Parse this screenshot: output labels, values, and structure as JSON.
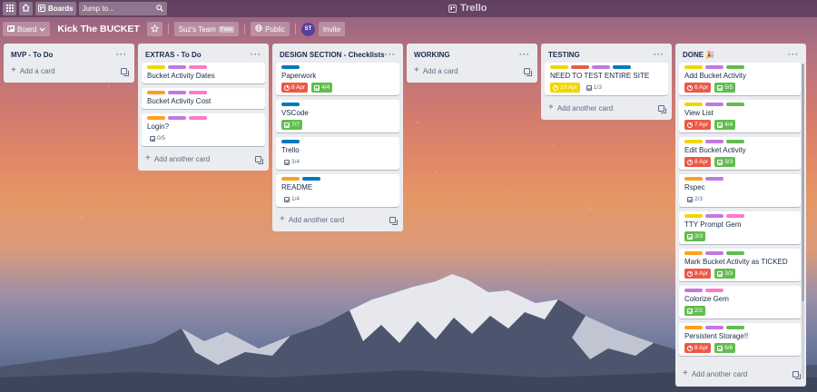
{
  "colors": {
    "yellow": "#f2d600",
    "purple": "#c377e0",
    "pink": "#ff78cb",
    "orange": "#ff9f1a",
    "blue": "#0079bf",
    "red": "#eb5a46",
    "green": "#61bd4f"
  },
  "topbar": {
    "apps_icon": "grid-icon",
    "home_icon": "home-icon",
    "boards_label": "Boards",
    "search_placeholder": "Jump to...",
    "logo_text": "Trello"
  },
  "boardbar": {
    "board_switcher_label": "Board",
    "board_title": "Kick The BUCKET",
    "team_label": "Suz's Team",
    "team_badge": "Free",
    "visibility_label": "Public",
    "avatar_initials": "ST",
    "invite_label": "Invite"
  },
  "add_card_label": "Add a card",
  "add_another_card_label": "Add another card",
  "lists": [
    {
      "title": "MVP - To Do",
      "cards": []
    },
    {
      "title": "EXTRAS - To Do",
      "cards": [
        {
          "title": "Bucket Activity Dates",
          "labels": [
            "yellow",
            "purple",
            "pink"
          ]
        },
        {
          "title": "Bucket Activity Cost",
          "labels": [
            "orange",
            "purple",
            "pink"
          ]
        },
        {
          "title": "Login?",
          "labels": [
            "orange",
            "purple",
            "pink"
          ],
          "checklist": "0/5"
        }
      ]
    },
    {
      "title": "DESIGN SECTION - Checklists",
      "cards": [
        {
          "title": "Paperwork",
          "labels": [
            "blue"
          ],
          "due": "8 Apr",
          "checklist_done": "4/4"
        },
        {
          "title": "VSCode",
          "labels": [
            "blue"
          ],
          "checklist_done": "7/7"
        },
        {
          "title": "Trello",
          "labels": [
            "blue"
          ],
          "checklist": "3/4"
        },
        {
          "title": "README",
          "labels": [
            "orange",
            "blue"
          ],
          "checklist": "1/4"
        }
      ]
    },
    {
      "title": "WORKING",
      "cards": []
    },
    {
      "title": "TESTING",
      "cards": [
        {
          "title": "NEED TO TEST ENTIRE SITE",
          "labels": [
            "yellow",
            "red",
            "purple",
            "blue"
          ],
          "due_yellow": "10 Apr",
          "checklist": "1/3"
        }
      ]
    },
    {
      "title": "DONE 🎉",
      "cards": [
        {
          "title": "Add Bucket Activity",
          "labels": [
            "yellow",
            "purple",
            "green"
          ],
          "due": "6 Apr",
          "checklist_done": "5/5"
        },
        {
          "title": "View List",
          "labels": [
            "yellow",
            "purple",
            "green"
          ],
          "due": "7 Apr",
          "checklist_done": "4/4"
        },
        {
          "title": "Edit Bucket Activity",
          "labels": [
            "yellow",
            "purple",
            "green"
          ],
          "due": "8 Apr",
          "checklist_done": "3/3"
        },
        {
          "title": "Rspec",
          "labels": [
            "orange",
            "purple"
          ],
          "checklist": "2/3"
        },
        {
          "title": "TTY Prompt Gem",
          "labels": [
            "yellow",
            "purple",
            "pink"
          ],
          "checklist_done": "3/3"
        },
        {
          "title": "Mark Bucket Activity as TICKED",
          "labels": [
            "orange",
            "purple",
            "green"
          ],
          "due": "8 Apr",
          "checklist_done": "3/3"
        },
        {
          "title": "Colorize Gem",
          "labels": [
            "purple",
            "pink"
          ],
          "checklist_done": "2/2"
        },
        {
          "title": "Persistent Storage!!",
          "labels": [
            "orange",
            "purple",
            "green"
          ],
          "due": "8 Apr",
          "checklist_done": "6/6"
        }
      ]
    }
  ]
}
